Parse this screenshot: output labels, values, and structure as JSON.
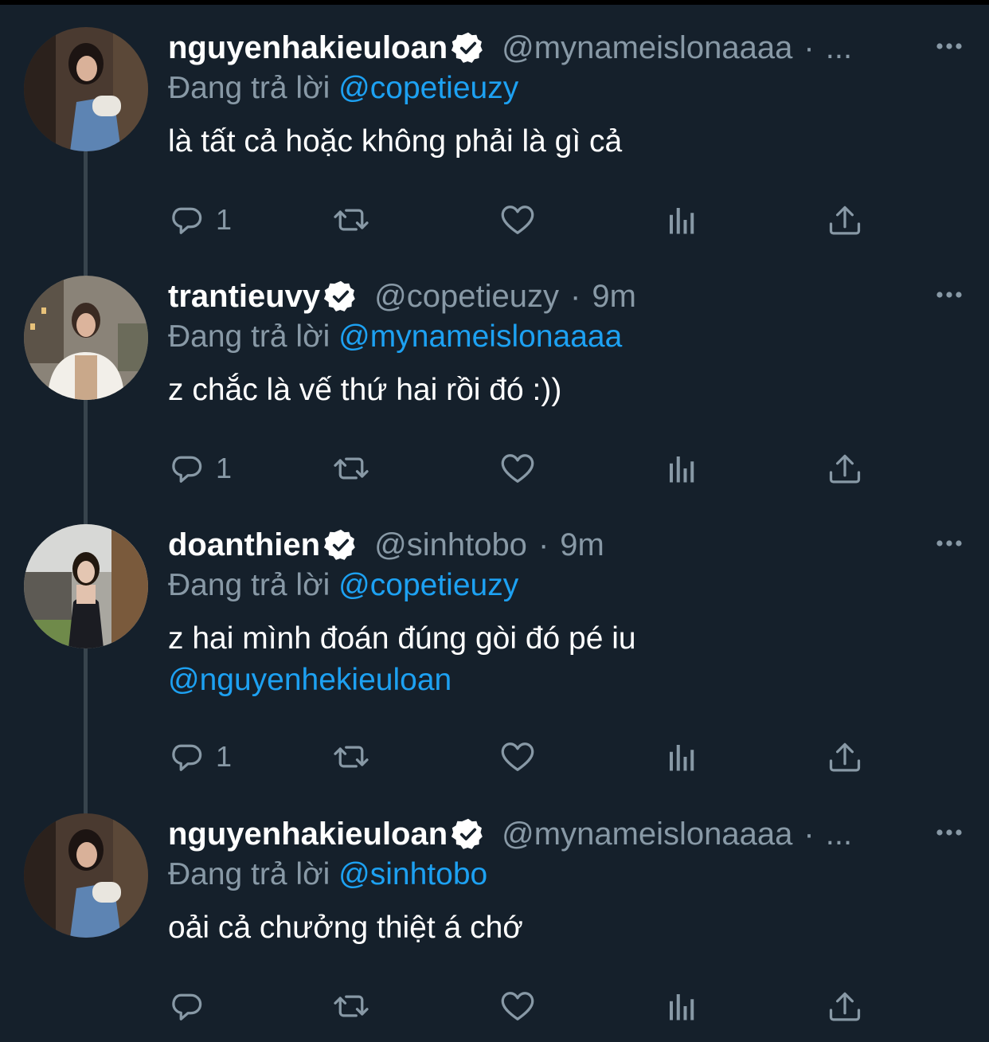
{
  "colors": {
    "background": "#15202b",
    "primary_text": "#ffffff",
    "secondary_text": "#8899a6",
    "link": "#1da1f2",
    "thread_line": "#38444d"
  },
  "icons": {
    "reply": "reply-icon",
    "retweet": "retweet-icon",
    "like": "heart-icon",
    "analytics": "analytics-icon",
    "share": "share-icon",
    "more": "more-dots-icon",
    "verified": "verified-badge-icon"
  },
  "tweets": [
    {
      "name": "nguyenhakieuloan",
      "handle": "@mynameislonaaaa",
      "sep": "·",
      "time": "...",
      "replying_label": "Đang trả lời",
      "replying_to": "@copetieuzy",
      "text": "là tất cả hoặc không phải là gì cả",
      "mention_line": "",
      "reply_count": "1"
    },
    {
      "name": "trantieuvy",
      "handle": "@copetieuzy",
      "sep": "·",
      "time": "9m",
      "replying_label": "Đang trả lời",
      "replying_to": "@mynameislonaaaa",
      "text": "z chắc là vế thứ hai rồi đó :))",
      "mention_line": "",
      "reply_count": "1"
    },
    {
      "name": "doanthien",
      "handle": "@sinhtobo",
      "sep": "·",
      "time": "9m",
      "replying_label": "Đang trả lời",
      "replying_to": "@copetieuzy",
      "text": "z hai mình đoán đúng gòi đó pé iu",
      "mention_line": "@nguyenhekieuloan",
      "reply_count": "1"
    },
    {
      "name": "nguyenhakieuloan",
      "handle": "@mynameislonaaaa",
      "sep": "·",
      "time": "...",
      "replying_label": "Đang trả lời",
      "replying_to": "@sinhtobo",
      "text": "oải cả chưởng thiệt á chớ",
      "mention_line": "",
      "reply_count": ""
    }
  ]
}
